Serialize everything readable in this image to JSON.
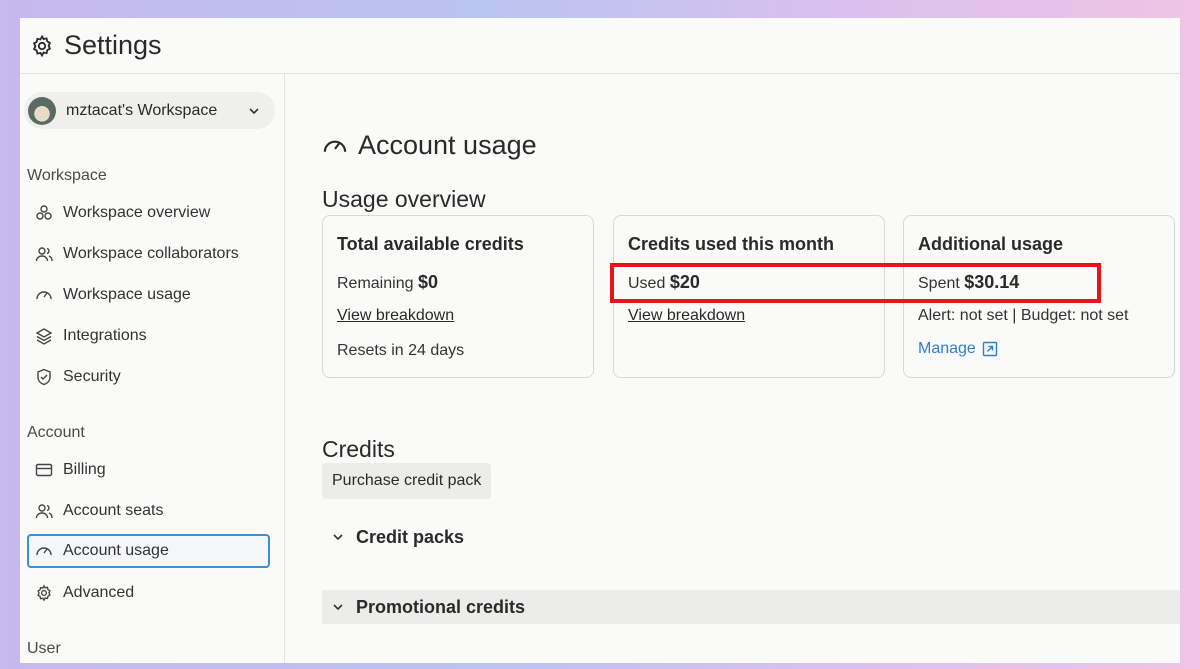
{
  "header": {
    "title": "Settings",
    "icon": "gear-icon"
  },
  "sidebar": {
    "workspace_selector": {
      "name": "mztacat's Workspace"
    },
    "sections": [
      {
        "label": "Workspace",
        "items": [
          {
            "label": "Workspace overview",
            "icon": "overview-icon"
          },
          {
            "label": "Workspace collaborators",
            "icon": "users-icon"
          },
          {
            "label": "Workspace usage",
            "icon": "gauge-icon"
          },
          {
            "label": "Integrations",
            "icon": "layers-icon"
          },
          {
            "label": "Security",
            "icon": "shield-icon"
          }
        ]
      },
      {
        "label": "Account",
        "items": [
          {
            "label": "Billing",
            "icon": "card-icon"
          },
          {
            "label": "Account seats",
            "icon": "users-icon"
          },
          {
            "label": "Account usage",
            "icon": "gauge-icon",
            "active": true
          },
          {
            "label": "Advanced",
            "icon": "gear-icon"
          }
        ]
      },
      {
        "label": "User",
        "items": []
      }
    ]
  },
  "main": {
    "title": "Account usage",
    "usage_overview": {
      "heading": "Usage overview",
      "cards": [
        {
          "title": "Total available credits",
          "line_label": "Remaining",
          "line_value": "$0",
          "link": "View breakdown",
          "extra": "Resets in 24 days"
        },
        {
          "title": "Credits used this month",
          "line_label": "Used",
          "line_value": "$20",
          "link": "View breakdown"
        },
        {
          "title": "Additional usage",
          "line_label": "Spent",
          "line_value": "$30.14",
          "extra": "Alert: not set | Budget: not set",
          "manage": "Manage"
        }
      ]
    },
    "credits": {
      "heading": "Credits",
      "purchase_button": "Purchase credit pack",
      "sections": [
        "Credit packs",
        "Promotional credits"
      ]
    }
  },
  "colors": {
    "accent": "#3b8fd8",
    "link": "#2f7fd0",
    "highlight": "#e8141a"
  }
}
